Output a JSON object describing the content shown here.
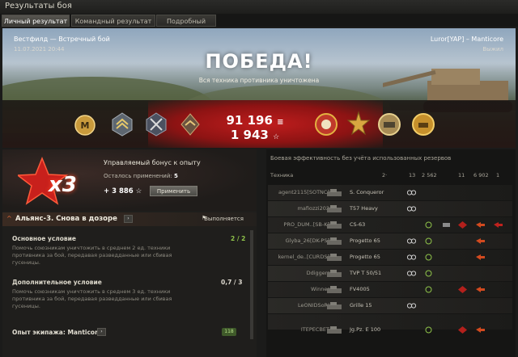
{
  "window": {
    "title": "Результаты боя"
  },
  "tabs": [
    {
      "label": "Личный результат",
      "active": true
    },
    {
      "label": "Командный результат",
      "active": false
    },
    {
      "label": "Подробный отчёт",
      "active": false
    }
  ],
  "battle": {
    "map_mode": "Вестфилд — Встречный бой",
    "datetime": "11.07.2021 20:44",
    "player": "Luror[YAP] – Manticore",
    "status": "Выжил",
    "result": "ПОБЕДА!",
    "result_sub": "Вся техника противника уничтожена",
    "credits": "91 196",
    "xp": "1 943"
  },
  "bonus": {
    "multiplier": "x3",
    "title": "Управляемый бонус к опыту",
    "remaining_label": "Осталось применений:",
    "remaining_value": "5",
    "value": "+ 3 886",
    "apply_label": "Применить"
  },
  "mission": {
    "name": "Альянс-3. Снова в дозоре",
    "status": "Выполняется",
    "main_title": "Основное условие",
    "main_text": "Помочь союзникам уничтожить в среднем 2 ед. техники противника за бой, передавая разведданные или сбивая гусеницы.",
    "main_progress": "2 / 2",
    "extra_title": "Дополнительное условие",
    "extra_text": "Помочь союзникам уничтожить в среднем 3 ед. техники противника за бой, передавая разведданные или сбивая гусеницы.",
    "extra_progress": "0,7 / 3",
    "crew_label": "Опыт экипажа: Manticore",
    "crew_badge": "118"
  },
  "efficiency": {
    "title": "Боевая эффективность без учёта использованных резервов",
    "col_vehicle": "Техника",
    "col_values": [
      "2·",
      "13",
      "2 562",
      "11",
      "6 902",
      "1"
    ],
    "rows": [
      {
        "player": "agent2115[SOTNC]",
        "tank": "S. Conqueror"
      },
      {
        "player": "mafiozzi202",
        "tank": "T57 Heavy"
      },
      {
        "player": "PRO_DUM..[SB-K]",
        "tank": "CS-63"
      },
      {
        "player": "Glyba_26[DK-PS]",
        "tank": "Progetto 65"
      },
      {
        "player": "kernel_de..[CURDS]",
        "tank": "Progetto 65"
      },
      {
        "player": "Ddiggerr",
        "tank": "TVP T 50/51"
      },
      {
        "player": "Winner",
        "tank": "FV4005"
      },
      {
        "player": "LeONIDSoRI",
        "tank": "Grille 15"
      },
      {
        "player": "ITEPECBET",
        "tank": "Jg.Pz. E 100"
      }
    ]
  },
  "colors": {
    "accent_red": "#b3201c",
    "progress_green": "#8fc34a",
    "gold": "#d9a640"
  },
  "icons": [
    "credits-icon",
    "xp-icon",
    "star-icon",
    "rank-m-icon",
    "chevron-icon",
    "flag-icon",
    "spot-icon",
    "damage-icon",
    "track-icon"
  ]
}
